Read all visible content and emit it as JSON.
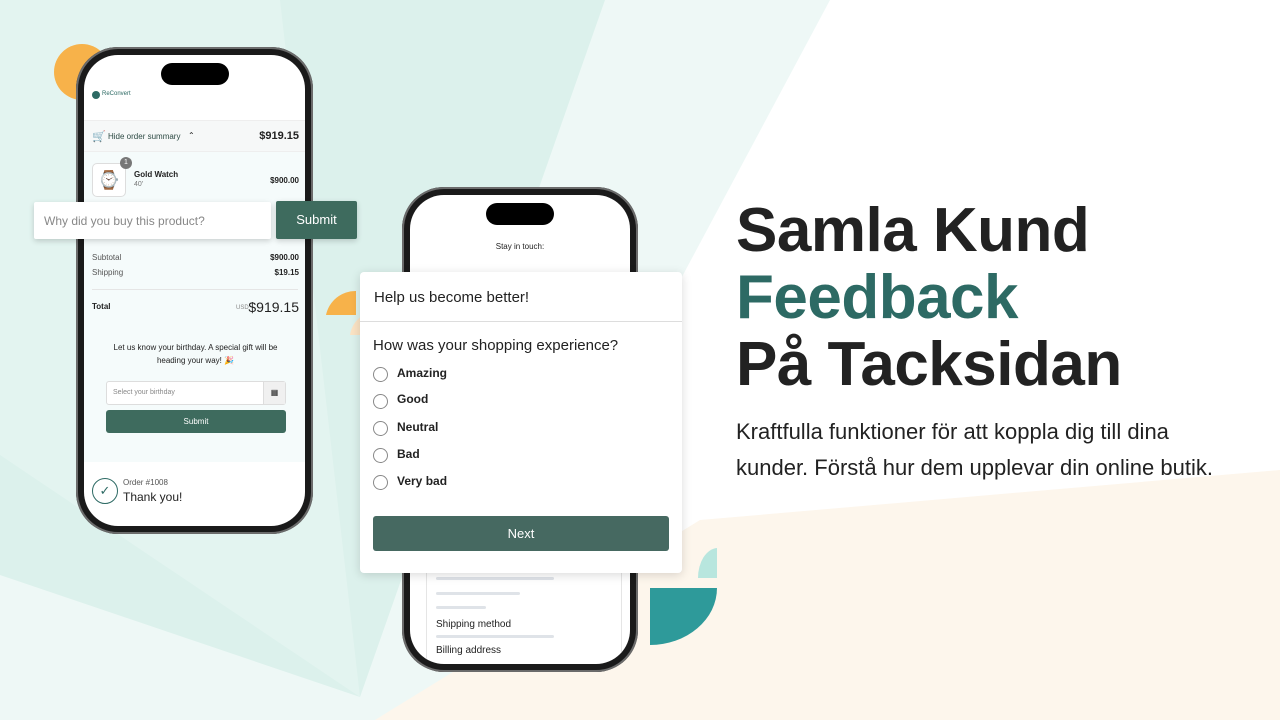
{
  "colors": {
    "accent": "#3e6b5e",
    "brand_teal": "#2d6a64",
    "mint": "#dff2ee",
    "peach": "#fdf6ec",
    "orange": "#f7b24a",
    "teal_shape": "#2e9a9a"
  },
  "phone1": {
    "logo": "ReConvert",
    "order_summary_toggle": "Hide order summary",
    "summary_total": "$919.15",
    "product": {
      "qty": "1",
      "name": "Gold Watch",
      "variant": "40'",
      "price": "$900.00"
    },
    "subtotal_label": "Subtotal",
    "subtotal": "$900.00",
    "shipping_label": "Shipping",
    "shipping": "$19.15",
    "total_label": "Total",
    "currency": "USD",
    "total": "$919.15",
    "birthday_text": "Let us know your birthday. A special gift will be heading your way! 🎉",
    "birthday_placeholder": "Select your birthday",
    "birthday_submit": "Submit",
    "order_number": "Order #1008",
    "thank_you": "Thank you!"
  },
  "question_widget": {
    "placeholder": "Why did you buy this product?",
    "submit": "Submit"
  },
  "phone2": {
    "stay_in_touch": "Stay in touch:",
    "social_icons": [
      "facebook-icon",
      "twitter-icon",
      "pinterest-icon",
      "linkedin-icon",
      "google-plus-icon"
    ],
    "shipping_method": "Shipping method",
    "billing_address": "Billing address"
  },
  "survey": {
    "title": "Help us become better!",
    "question": "How was your shopping experience?",
    "options": [
      "Amazing",
      "Good",
      "Neutral",
      "Bad",
      "Very bad"
    ],
    "next": "Next"
  },
  "hero": {
    "line1": "Samla Kund",
    "line2": "Feedback",
    "line3": "På Tacksidan",
    "description_line1": "Kraftfulla funktioner för att koppla dig till dina",
    "description_line2": "kunder. Förstå hur dem upplevar din online butik."
  }
}
